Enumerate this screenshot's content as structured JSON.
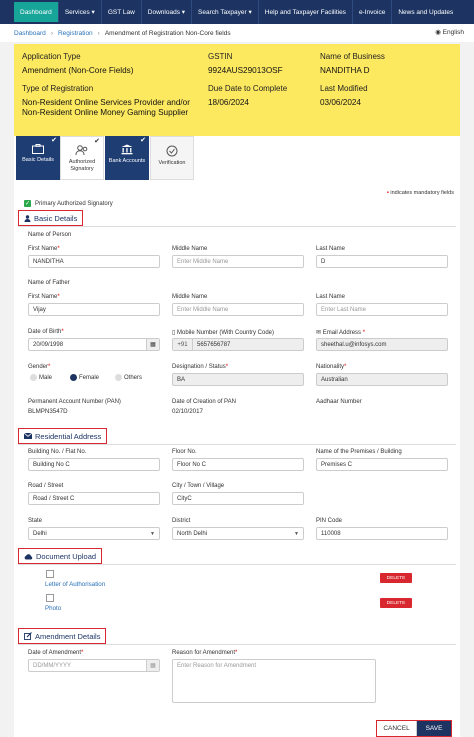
{
  "nav": {
    "items": [
      "Dashboard",
      "Services ▾",
      "GST Law",
      "Downloads ▾",
      "Search Taxpayer ▾",
      "Help and Taxpayer Facilities",
      "e-Invoice",
      "News and Updates"
    ],
    "active_index": 0
  },
  "breadcrumb": {
    "items": [
      "Dashboard",
      "Registration",
      "Amendment of Registration Non-Core fields"
    ],
    "language": "English"
  },
  "summary": {
    "app_type_label": "Application Type",
    "app_type_value": "Amendment (Non-Core Fields)",
    "gstin_label": "GSTIN",
    "gstin_value": "9924AUS29013OSF",
    "business_label": "Name of Business",
    "business_value": "NANDITHA D",
    "reg_type_label": "Type of Registration",
    "reg_type_value": "Non-Resident Online Services Provider and/or Non-Resident Online Money Gaming Supplier",
    "due_label": "Due Date to Complete",
    "due_value": "18/06/2024",
    "modified_label": "Last Modified",
    "modified_value": "03/06/2024"
  },
  "steps": [
    {
      "label": "Basic Details",
      "status": "done",
      "icon": "briefcase-icon"
    },
    {
      "label": "Authorized Signatory",
      "status": "current",
      "icon": "users-icon"
    },
    {
      "label": "Bank Accounts",
      "status": "done",
      "icon": "bank-icon"
    },
    {
      "label": "Verification",
      "status": "todo",
      "icon": "check-circle-icon"
    }
  ],
  "form": {
    "mandatory_note": "indicates mandatory fields",
    "primary_signatory_label": "Primary Authorized Signatory",
    "basic": {
      "title": "Basic Details",
      "name_person_label": "Name of Person",
      "first_name_label": "First Name",
      "first_name_value": "NANDITHA",
      "middle_name_label": "Middle Name",
      "middle_name_placeholder": "Enter Middle Name",
      "last_name_label": "Last Name",
      "last_name_value": "D",
      "name_father_label": "Name of Father",
      "f_first_name_value": "Vijay",
      "f_middle_placeholder": "Enter Middle Name",
      "f_last_placeholder": "Enter Last Name",
      "dob_label": "Date of Birth",
      "dob_value": "20/09/1998",
      "mobile_label": "Mobile Number (With Country Code)",
      "mobile_cc": "+91",
      "mobile_value": "5657656787",
      "email_label": "Email Address",
      "email_value": "sheethal.u@infosys.com",
      "gender_label": "Gender",
      "gender_options": [
        "Male",
        "Female",
        "Others"
      ],
      "gender_selected": "Female",
      "designation_label": "Designation / Status",
      "designation_value": "BA",
      "nationality_label": "Nationality",
      "nationality_value": "Australian",
      "pan_label": "Permanent Account Number (PAN)",
      "pan_value": "BLMPN3547D",
      "pan_date_label": "Date of Creation of PAN",
      "pan_date_value": "02/10/2017",
      "aadhaar_label": "Aadhaar Number"
    },
    "residential": {
      "title": "Residential Address",
      "building_label": "Building No. / Flat No.",
      "building_value": "Building No C",
      "floor_label": "Floor No.",
      "floor_value": "Floor No C",
      "premises_label": "Name of the Premises / Building",
      "premises_value": "Premises C",
      "road_label": "Road / Street",
      "road_value": "Road / Street C",
      "city_label": "City / Town / Village",
      "city_value": "CityC",
      "state_label": "State",
      "state_value": "Delhi",
      "district_label": "District",
      "district_value": "North Delhi",
      "pin_label": "PIN Code",
      "pin_value": "110008"
    },
    "documents": {
      "title": "Document Upload",
      "files": [
        "Letter of Authorisation",
        "Photo"
      ],
      "delete_label": "DELETE"
    },
    "amendment": {
      "title": "Amendment Details",
      "date_label": "Date of Amendment",
      "date_placeholder": "DD/MM/YYYY",
      "reason_label": "Reason for Amendment",
      "reason_placeholder": "Enter Reason for Amendment"
    },
    "buttons": {
      "cancel": "CANCEL",
      "save": "SAVE"
    }
  },
  "colors": {
    "nav": "#1d3463",
    "active": "#18a599",
    "summary_bg": "#fde960",
    "highlight": "#d8272e"
  }
}
